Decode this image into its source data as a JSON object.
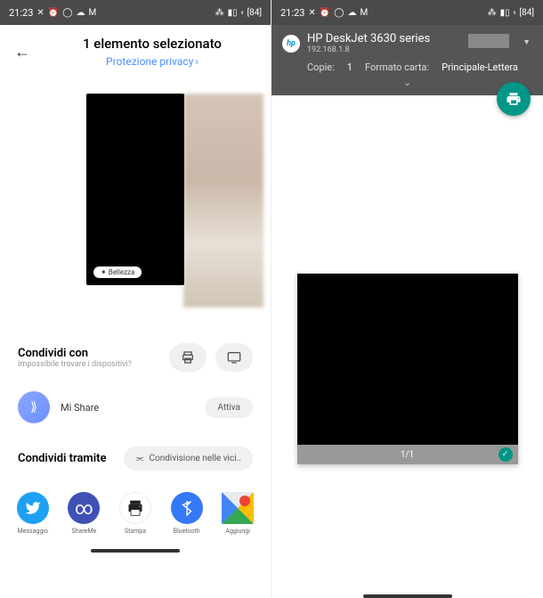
{
  "status": {
    "time": "21:23",
    "battery": "84"
  },
  "left": {
    "title": "1 elemento selezionato",
    "privacy": "Protezione privacy",
    "preview_chip": "Bellezza",
    "share_with": "Condividi con",
    "share_with_sub": "Impossibile trovare i dispositivi?",
    "mishare": "Mi Share",
    "attiva": "Attiva",
    "share_via": "Condividi tramite",
    "nearby": "Condivisione nelle vici..",
    "apps": {
      "twitter": "Messaggio",
      "shareme": "ShareMe",
      "stampa": "Stampa",
      "bluetooth": "Bluetooth",
      "maps": "Aggiungi"
    }
  },
  "right": {
    "printer_name": "HP DeskJet 3630 series",
    "printer_ip": "192.168.1.8",
    "copies_label": "Copie:",
    "copies_val": "1",
    "format_label": "Formato carta:",
    "format_val": "Principale-Lettera",
    "page_counter": "1/1"
  }
}
